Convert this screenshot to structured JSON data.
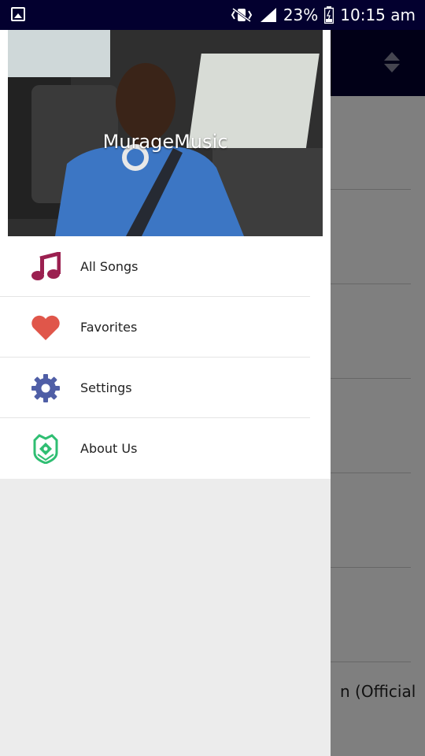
{
  "status_bar": {
    "battery": "23%",
    "time": "10:15 am"
  },
  "drawer": {
    "header": {
      "username": "MurageMusic"
    },
    "items": [
      {
        "label": "All Songs",
        "icon": "music-note-icon",
        "color": "#9b2050"
      },
      {
        "label": "Favorites",
        "icon": "heart-icon",
        "color": "#e0564a"
      },
      {
        "label": "Settings",
        "icon": "gear-icon",
        "color": "#4f5ea6"
      },
      {
        "label": "About Us",
        "icon": "shield-crest-icon",
        "color": "#2fbe72"
      }
    ]
  },
  "background": {
    "partial_song_title": "n (Official"
  },
  "colors": {
    "status_bar": "#03002f",
    "app_bar": "#03002f",
    "drawer_bg": "#ececec"
  }
}
